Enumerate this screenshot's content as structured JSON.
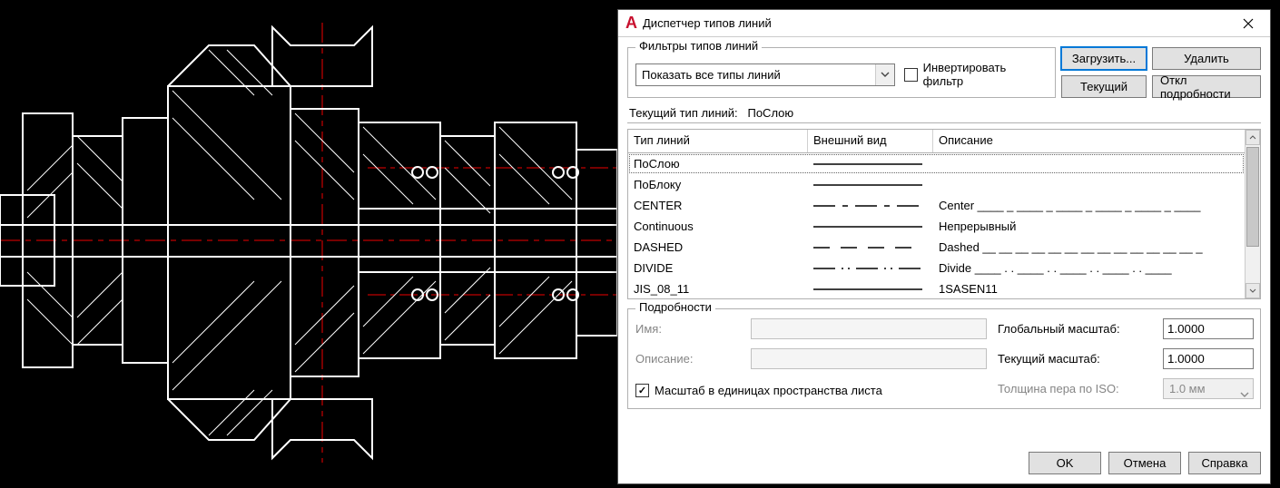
{
  "dialog": {
    "title": "Диспетчер типов линий",
    "filters": {
      "legend": "Фильтры типов линий",
      "dropdown_value": "Показать все типы линий",
      "invert_label": "Инвертировать фильтр",
      "invert_checked": false
    },
    "buttons": {
      "load": "Загрузить...",
      "delete": "Удалить",
      "current": "Текущий",
      "toggle_details": "Откл подробности"
    },
    "current_linetype": {
      "label": "Текущий тип линий:",
      "value": "ПоСлою"
    },
    "table": {
      "headers": {
        "name": "Тип линий",
        "appearance": "Внешний вид",
        "description": "Описание"
      },
      "rows": [
        {
          "name": "ПоСлою",
          "pattern": "solid",
          "description": "",
          "selected": true
        },
        {
          "name": "ПоБлоку",
          "pattern": "solid",
          "description": ""
        },
        {
          "name": "CENTER",
          "pattern": "center",
          "description": "Center ____ _ ____ _ ____ _ ____ _ ____ _ ____"
        },
        {
          "name": "Continuous",
          "pattern": "solid",
          "description": "Непрерывный"
        },
        {
          "name": "DASHED",
          "pattern": "dashed",
          "description": "Dashed __ __ __ __ __ __ __ __ __ __ __ __ __ _"
        },
        {
          "name": "DIVIDE",
          "pattern": "divide",
          "description": "Divide ____ . . ____ . . ____ . . ____ . . ____"
        },
        {
          "name": "JIS_08_11",
          "pattern": "solid",
          "description": "1SASEN11"
        }
      ]
    },
    "details": {
      "legend": "Подробности",
      "name_label": "Имя:",
      "name_value": "",
      "desc_label": "Описание:",
      "desc_value": "",
      "global_scale_label": "Глобальный масштаб:",
      "global_scale_value": "1.0000",
      "current_scale_label": "Текущий масштаб:",
      "current_scale_value": "1.0000",
      "pen_width_label": "Толщина пера по ISO:",
      "pen_width_value": "1.0 мм",
      "paper_units_label": "Масштаб в единицах пространства листа",
      "paper_units_checked": true
    },
    "footer": {
      "ok": "OK",
      "cancel": "Отмена",
      "help": "Справка"
    }
  }
}
